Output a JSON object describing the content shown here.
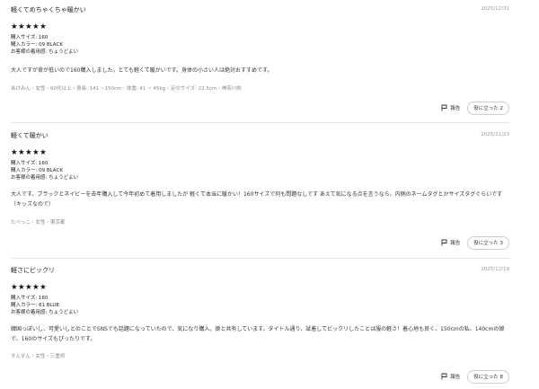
{
  "reviews": [
    {
      "title": "軽くてめちゃくちゃ暖かい",
      "date": "2025/12/31",
      "rating": 5,
      "stars": "★★★★★",
      "size": "購入サイズ: 160",
      "color": "購入カラー: 09 BLACK",
      "fit": "お客様の着用感: ちょうどよい",
      "body": "大人ですが背が低いので160購入しました。とても軽くて暖かいです。身体の小さい人は絶対おすすめです。",
      "reviewer": "あけみん・女性・60代以上・身長: 141 ~150cm・体重: 41 ~ 45kg・足のサイズ: 22.5cm・神奈川県",
      "report": "報告",
      "helpful": "役に立った 2"
    },
    {
      "title": "軽くて暖かい",
      "date": "2025/11/23",
      "rating": 5,
      "stars": "★★★★★",
      "size": "購入サイズ: 160",
      "color": "購入カラー: 09 BLACK",
      "fit": "お客様の着用感: ちょうどよい",
      "body": "大人です。ブラックとネイビーを去年購入して今年初めて着用しましたが 軽くて本当に暖かい！160サイズで何も問題なしです あえて気になる点を言うなら、内側のネームタグとかサイズタグぐらいです（キッズなので）",
      "reviewer": "たべっこ・女性・東京都",
      "report": "報告",
      "helpful": "役に立った 3"
    },
    {
      "title": "軽さにビックリ",
      "date": "2025/12/19",
      "rating": 5,
      "stars": "★★★★★",
      "size": "購入サイズ: 160",
      "color": "購入カラー: 61 BLUE",
      "fit": "お客様の着用感: ちょうどよい",
      "body": "韓国っぽいし、可愛いしとのことでSNSでも話題になっていたので、気になり購入。娘と共有しています。タイトル通り、試着してビックリしたことは服の軽さ！着心地も良く、150cmの私、140cmの娘で、160のサイズもぴったりです。",
      "reviewer": "すんすん・女性・三重県",
      "report": "報告",
      "helpful": "役に立った 8"
    }
  ]
}
